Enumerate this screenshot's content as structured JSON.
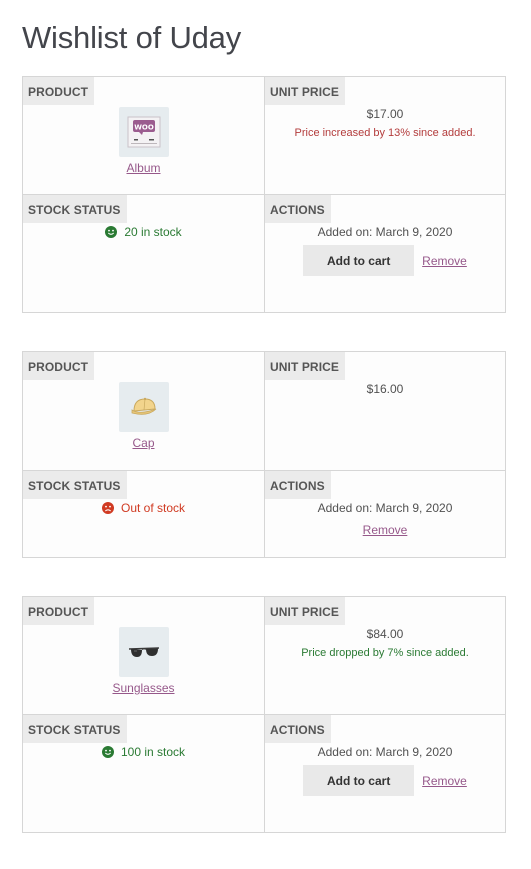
{
  "page": {
    "title": "Wishlist of Uday"
  },
  "labels": {
    "product": "PRODUCT",
    "unit_price": "UNIT PRICE",
    "stock_status": "STOCK STATUS",
    "actions": "ACTIONS",
    "add_to_cart": "Add to cart",
    "remove": "Remove"
  },
  "items": [
    {
      "name": "Album",
      "thumb_icon": "woo-album-icon",
      "price": "$17.00",
      "price_note": "Price increased by 13% since added.",
      "price_note_type": "increase",
      "stock": "20 in stock",
      "stock_state": "in-stock",
      "added": "Added on: March 9, 2020",
      "has_add_to_cart": true
    },
    {
      "name": "Cap",
      "thumb_icon": "cap-icon",
      "price": "$16.00",
      "price_note": "",
      "stock": "Out of stock",
      "stock_state": "out-of-stock",
      "added": "Added on: March 9, 2020",
      "has_add_to_cart": false
    },
    {
      "name": "Sunglasses",
      "thumb_icon": "sunglasses-icon",
      "price": "$84.00",
      "price_note": "Price dropped by 7% since added.",
      "price_note_type": "decrease",
      "stock": "100 in stock",
      "stock_state": "in-stock",
      "added": "Added on: March 9, 2020",
      "has_add_to_cart": true
    }
  ],
  "colors": {
    "link": "#96588a",
    "in_stock": "#2a7a33",
    "out_of_stock": "#d03a22",
    "price_increase": "#b33c3c",
    "price_decrease": "#2a7a33"
  }
}
